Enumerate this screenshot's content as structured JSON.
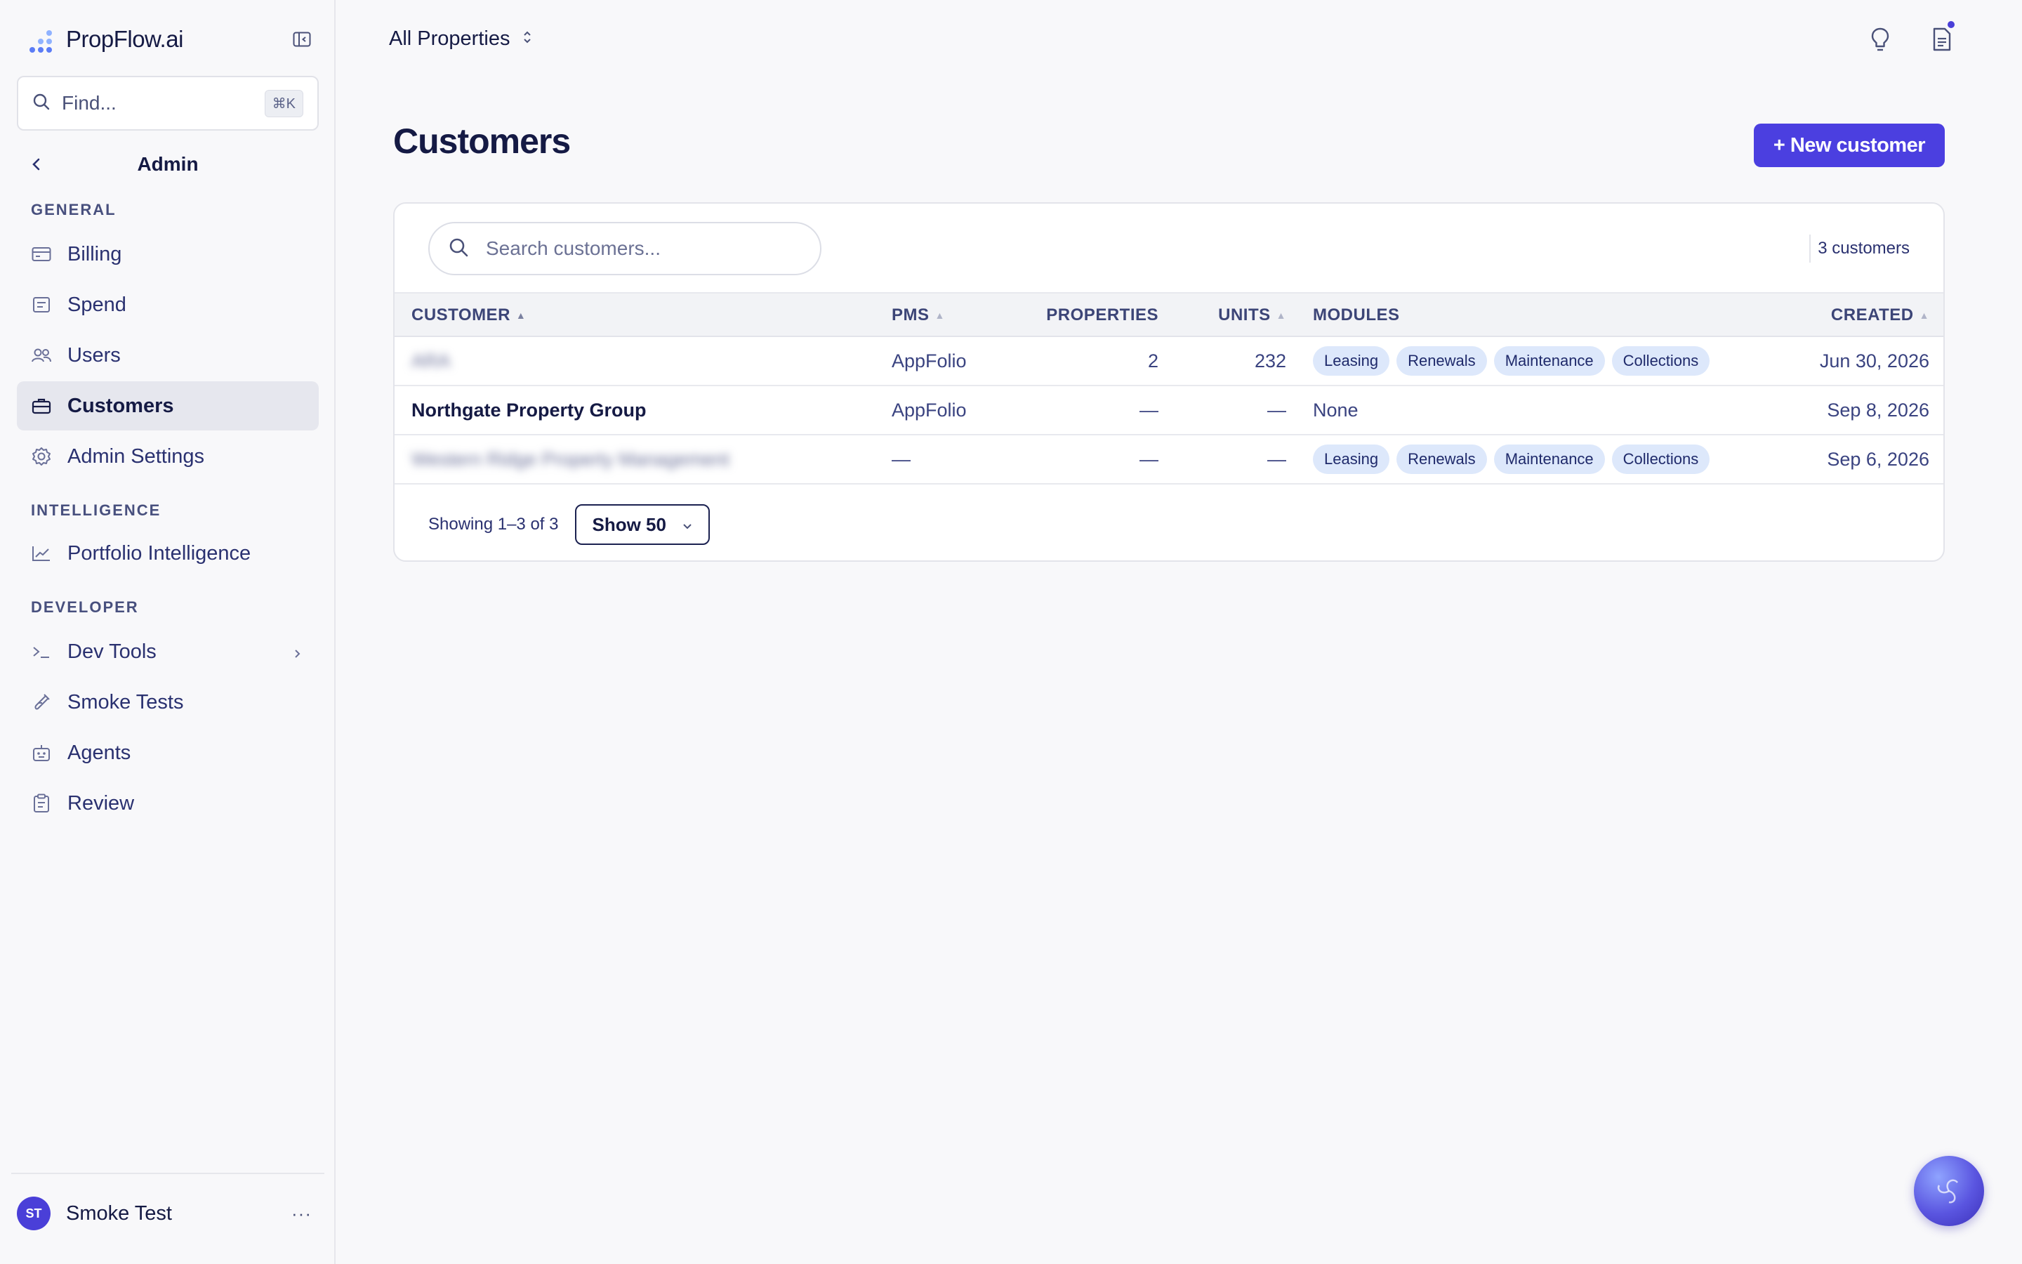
{
  "brand": {
    "name": "PropFlow.ai",
    "colors": {
      "accent": "#4b3fe0",
      "dot_blue": "#5b7cf6",
      "dot_light": "#8fb2ff"
    }
  },
  "sidebar": {
    "find": {
      "placeholder": "Find...",
      "shortcut": "⌘K"
    },
    "section_title": "Admin",
    "groups": [
      {
        "label": "GENERAL",
        "items": [
          {
            "label": "Billing",
            "icon": "credit-card-icon"
          },
          {
            "label": "Spend",
            "icon": "receipt-icon"
          },
          {
            "label": "Users",
            "icon": "users-icon"
          },
          {
            "label": "Customers",
            "icon": "briefcase-icon",
            "active": true
          },
          {
            "label": "Admin Settings",
            "icon": "gear-icon"
          }
        ]
      },
      {
        "label": "INTELLIGENCE",
        "items": [
          {
            "label": "Portfolio Intelligence",
            "icon": "trend-chart-icon"
          }
        ]
      },
      {
        "label": "DEVELOPER",
        "items": [
          {
            "label": "Dev Tools",
            "icon": "terminal-icon",
            "has_submenu": true
          },
          {
            "label": "Smoke Tests",
            "icon": "test-tube-icon"
          },
          {
            "label": "Agents",
            "icon": "robot-icon"
          },
          {
            "label": "Review",
            "icon": "clipboard-icon"
          }
        ]
      }
    ],
    "user": {
      "initials": "ST",
      "name": "Smoke Test",
      "menu": "···"
    }
  },
  "topbar": {
    "property_selector": "All Properties"
  },
  "page": {
    "title": "Customers",
    "new_button": "+ New customer",
    "search_placeholder": "Search customers...",
    "count_label": "3 customers",
    "columns": [
      "CUSTOMER",
      "PMS",
      "PROPERTIES",
      "UNITS",
      "MODULES",
      "CREATED"
    ],
    "rows": [
      {
        "customer": "ARA",
        "customer_blurred": true,
        "pms": "AppFolio",
        "properties": "2",
        "units": "232",
        "modules": [
          "Leasing",
          "Renewals",
          "Maintenance",
          "Collections"
        ],
        "modules_text": "",
        "created": "Jun 30, 2026"
      },
      {
        "customer": "Northgate Property Group",
        "customer_blurred": false,
        "pms": "AppFolio",
        "properties": "—",
        "units": "—",
        "modules": [],
        "modules_text": "None",
        "created": "Sep 8, 2026"
      },
      {
        "customer": "Western Ridge Property Management",
        "customer_blurred": true,
        "pms": "—",
        "properties": "—",
        "units": "—",
        "modules": [
          "Leasing",
          "Renewals",
          "Maintenance",
          "Collections"
        ],
        "modules_text": "",
        "created": "Sep 6, 2026"
      }
    ],
    "pager": {
      "showing": "Showing 1–3 of 3",
      "page_size": "Show 50"
    }
  }
}
